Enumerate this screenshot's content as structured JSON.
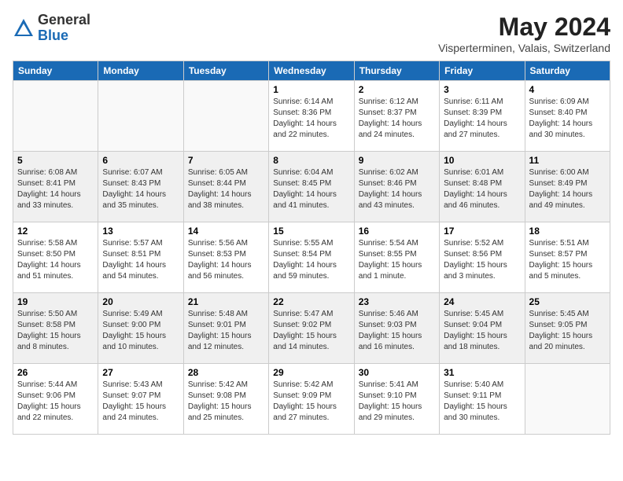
{
  "header": {
    "logo_general": "General",
    "logo_blue": "Blue",
    "month": "May 2024",
    "location": "Visperterminen, Valais, Switzerland"
  },
  "weekdays": [
    "Sunday",
    "Monday",
    "Tuesday",
    "Wednesday",
    "Thursday",
    "Friday",
    "Saturday"
  ],
  "weeks": [
    [
      {
        "day": "",
        "info": ""
      },
      {
        "day": "",
        "info": ""
      },
      {
        "day": "",
        "info": ""
      },
      {
        "day": "1",
        "info": "Sunrise: 6:14 AM\nSunset: 8:36 PM\nDaylight: 14 hours\nand 22 minutes."
      },
      {
        "day": "2",
        "info": "Sunrise: 6:12 AM\nSunset: 8:37 PM\nDaylight: 14 hours\nand 24 minutes."
      },
      {
        "day": "3",
        "info": "Sunrise: 6:11 AM\nSunset: 8:39 PM\nDaylight: 14 hours\nand 27 minutes."
      },
      {
        "day": "4",
        "info": "Sunrise: 6:09 AM\nSunset: 8:40 PM\nDaylight: 14 hours\nand 30 minutes."
      }
    ],
    [
      {
        "day": "5",
        "info": "Sunrise: 6:08 AM\nSunset: 8:41 PM\nDaylight: 14 hours\nand 33 minutes."
      },
      {
        "day": "6",
        "info": "Sunrise: 6:07 AM\nSunset: 8:43 PM\nDaylight: 14 hours\nand 35 minutes."
      },
      {
        "day": "7",
        "info": "Sunrise: 6:05 AM\nSunset: 8:44 PM\nDaylight: 14 hours\nand 38 minutes."
      },
      {
        "day": "8",
        "info": "Sunrise: 6:04 AM\nSunset: 8:45 PM\nDaylight: 14 hours\nand 41 minutes."
      },
      {
        "day": "9",
        "info": "Sunrise: 6:02 AM\nSunset: 8:46 PM\nDaylight: 14 hours\nand 43 minutes."
      },
      {
        "day": "10",
        "info": "Sunrise: 6:01 AM\nSunset: 8:48 PM\nDaylight: 14 hours\nand 46 minutes."
      },
      {
        "day": "11",
        "info": "Sunrise: 6:00 AM\nSunset: 8:49 PM\nDaylight: 14 hours\nand 49 minutes."
      }
    ],
    [
      {
        "day": "12",
        "info": "Sunrise: 5:58 AM\nSunset: 8:50 PM\nDaylight: 14 hours\nand 51 minutes."
      },
      {
        "day": "13",
        "info": "Sunrise: 5:57 AM\nSunset: 8:51 PM\nDaylight: 14 hours\nand 54 minutes."
      },
      {
        "day": "14",
        "info": "Sunrise: 5:56 AM\nSunset: 8:53 PM\nDaylight: 14 hours\nand 56 minutes."
      },
      {
        "day": "15",
        "info": "Sunrise: 5:55 AM\nSunset: 8:54 PM\nDaylight: 14 hours\nand 59 minutes."
      },
      {
        "day": "16",
        "info": "Sunrise: 5:54 AM\nSunset: 8:55 PM\nDaylight: 15 hours\nand 1 minute."
      },
      {
        "day": "17",
        "info": "Sunrise: 5:52 AM\nSunset: 8:56 PM\nDaylight: 15 hours\nand 3 minutes."
      },
      {
        "day": "18",
        "info": "Sunrise: 5:51 AM\nSunset: 8:57 PM\nDaylight: 15 hours\nand 5 minutes."
      }
    ],
    [
      {
        "day": "19",
        "info": "Sunrise: 5:50 AM\nSunset: 8:58 PM\nDaylight: 15 hours\nand 8 minutes."
      },
      {
        "day": "20",
        "info": "Sunrise: 5:49 AM\nSunset: 9:00 PM\nDaylight: 15 hours\nand 10 minutes."
      },
      {
        "day": "21",
        "info": "Sunrise: 5:48 AM\nSunset: 9:01 PM\nDaylight: 15 hours\nand 12 minutes."
      },
      {
        "day": "22",
        "info": "Sunrise: 5:47 AM\nSunset: 9:02 PM\nDaylight: 15 hours\nand 14 minutes."
      },
      {
        "day": "23",
        "info": "Sunrise: 5:46 AM\nSunset: 9:03 PM\nDaylight: 15 hours\nand 16 minutes."
      },
      {
        "day": "24",
        "info": "Sunrise: 5:45 AM\nSunset: 9:04 PM\nDaylight: 15 hours\nand 18 minutes."
      },
      {
        "day": "25",
        "info": "Sunrise: 5:45 AM\nSunset: 9:05 PM\nDaylight: 15 hours\nand 20 minutes."
      }
    ],
    [
      {
        "day": "26",
        "info": "Sunrise: 5:44 AM\nSunset: 9:06 PM\nDaylight: 15 hours\nand 22 minutes."
      },
      {
        "day": "27",
        "info": "Sunrise: 5:43 AM\nSunset: 9:07 PM\nDaylight: 15 hours\nand 24 minutes."
      },
      {
        "day": "28",
        "info": "Sunrise: 5:42 AM\nSunset: 9:08 PM\nDaylight: 15 hours\nand 25 minutes."
      },
      {
        "day": "29",
        "info": "Sunrise: 5:42 AM\nSunset: 9:09 PM\nDaylight: 15 hours\nand 27 minutes."
      },
      {
        "day": "30",
        "info": "Sunrise: 5:41 AM\nSunset: 9:10 PM\nDaylight: 15 hours\nand 29 minutes."
      },
      {
        "day": "31",
        "info": "Sunrise: 5:40 AM\nSunset: 9:11 PM\nDaylight: 15 hours\nand 30 minutes."
      },
      {
        "day": "",
        "info": ""
      }
    ]
  ]
}
